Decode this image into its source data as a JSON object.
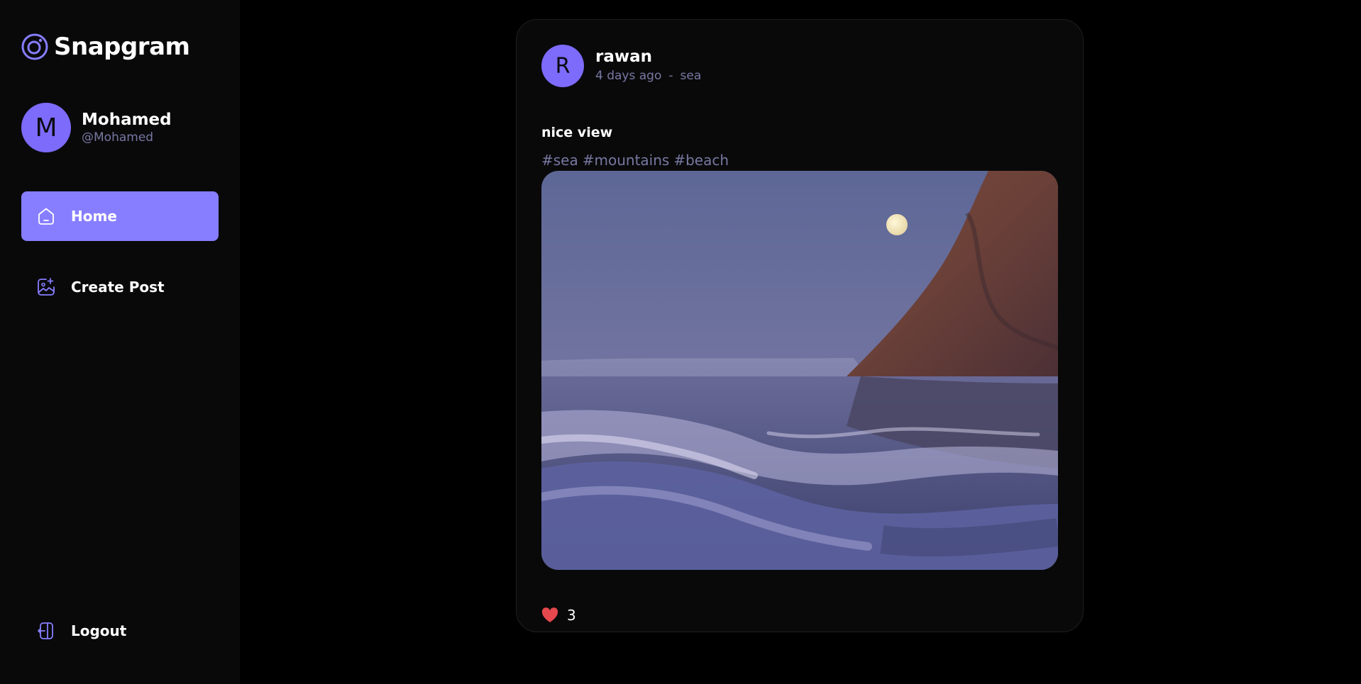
{
  "brand": {
    "name": "Snapgram",
    "accent": "#877eff",
    "avatar_color": "#7d6bfb"
  },
  "user": {
    "initial": "M",
    "name": "Mohamed",
    "handle": "@Mohamed"
  },
  "nav": {
    "home": {
      "label": "Home",
      "icon": "home-icon",
      "active": true
    },
    "create_post": {
      "label": "Create Post",
      "icon": "gallery-add-icon"
    },
    "logout": {
      "label": "Logout",
      "icon": "logout-icon"
    }
  },
  "post": {
    "author_initial": "R",
    "author": "rawan",
    "time_ago": "4 days ago",
    "separator": "-",
    "location": "sea",
    "caption": "nice view",
    "tags": [
      "#sea",
      "#mountains",
      "#beach"
    ],
    "image_alt_icon": "photo",
    "likes": "3",
    "liked": true,
    "like_color": "#e5484d"
  }
}
